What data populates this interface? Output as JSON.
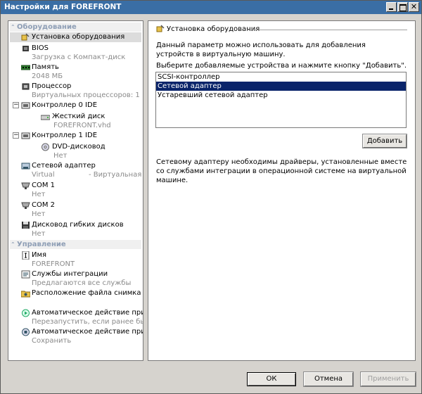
{
  "window": {
    "title": "Настройки для FOREFRONT"
  },
  "sections": {
    "hardware": "Оборудование",
    "management": "Управление"
  },
  "items": {
    "add_hardware": {
      "label": "Установка оборудования"
    },
    "bios": {
      "label": "BIOS",
      "sub": "Загрузка с Компакт-диск"
    },
    "memory": {
      "label": "Память",
      "sub": "2048 МБ"
    },
    "processor": {
      "label": "Процессор",
      "sub": "Виртуальных процессоров: 1"
    },
    "ide0": {
      "label": "Контроллер 0 IDE"
    },
    "hdd": {
      "label": "Жесткий диск",
      "sub": "FOREFRONT.vhd"
    },
    "ide1": {
      "label": "Контроллер 1 IDE"
    },
    "dvd": {
      "label": "DVD-дисковод",
      "sub": "Нет"
    },
    "nic": {
      "label": "Сетевой адаптер",
      "sub": "Virtual",
      "sub2": "- Виртуальная сеть"
    },
    "com1": {
      "label": "COM 1",
      "sub": "Нет"
    },
    "com2": {
      "label": "COM 2",
      "sub": "Нет"
    },
    "floppy": {
      "label": "Дисковод гибких дисков",
      "sub": "Нет"
    },
    "name": {
      "label": "Имя",
      "sub": "FOREFRONT"
    },
    "integration": {
      "label": "Службы интеграции",
      "sub": "Предлагаются все службы"
    },
    "snapshot": {
      "label": "Расположение файла снимка"
    },
    "autostart": {
      "label": "Автоматическое действие при за...",
      "sub": "Перезапустить, если ранее был ..."
    },
    "autostop": {
      "label": "Автоматическое действие при за...",
      "sub": "Сохранить"
    }
  },
  "right": {
    "title": "Установка оборудования",
    "desc": "Данный параметр можно использовать для добавления устройств в виртуальную машину.",
    "prompt": "Выберите добавляемые устройства и нажмите кнопку \"Добавить\".",
    "devices": [
      "SCSI-контроллер",
      "Сетевой адаптер",
      "Устаревший сетевой адаптер"
    ],
    "selected_index": 1,
    "add_button": "Добавить",
    "note": "Сетевому адаптеру необходимы драйверы, установленные вместе со службами интеграции в операционной системе на виртуальной машине."
  },
  "buttons": {
    "ok": "ОК",
    "cancel": "Отмена",
    "apply": "Применить"
  },
  "colors": {
    "titlebar": "#3a6ea5",
    "selection": "#0a246a",
    "section_text": "#8e9eb5"
  }
}
